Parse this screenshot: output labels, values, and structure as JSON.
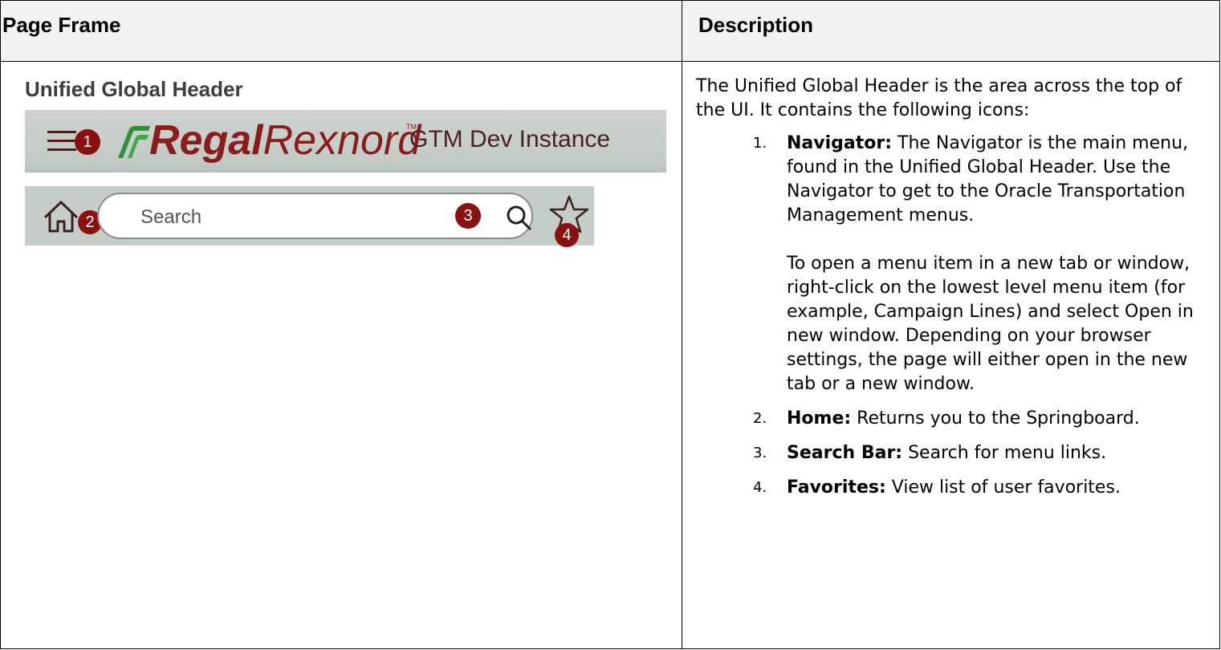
{
  "header": {
    "left": "Page Frame",
    "right": "Description"
  },
  "left": {
    "title": "Unified Global Header",
    "banner": {
      "logo_bold": "Regal",
      "logo_light": "Rexnord",
      "logo_tm": "TM",
      "instance": "GTM Dev Instance"
    },
    "search": {
      "placeholder": "Search"
    },
    "badges": [
      "1",
      "2",
      "3",
      "4"
    ],
    "colors": {
      "badge": "#8b1010",
      "banner": "#c5cdc8",
      "logo": "#8b1c1c"
    },
    "icons": [
      "hamburger-icon",
      "logo-mark-icon",
      "home-icon",
      "search-icon",
      "star-icon"
    ]
  },
  "description": {
    "intro": "The Unified Global Header is the area across the top of the UI. It contains the following icons:",
    "items": [
      {
        "num": "1.",
        "label": "Navigator:",
        "text": " The Navigator is the main menu, found in the Unified Global Header. Use the Navigator to get to the Oracle Transportation Management menus.",
        "extra": "To open a menu item in a new tab or window, right-click on the lowest level menu item (for example, Campaign Lines) and select Open in new window. Depending on your browser settings, the page will either open in the new tab or a new window."
      },
      {
        "num": "2.",
        "label": "Home:",
        "text": " Returns you to the Springboard."
      },
      {
        "num": "3.",
        "label": "Search Bar:",
        "text": " Search for menu links."
      },
      {
        "num": "4.",
        "label": "Favorites:",
        "text": " View list of user favorites."
      }
    ]
  }
}
